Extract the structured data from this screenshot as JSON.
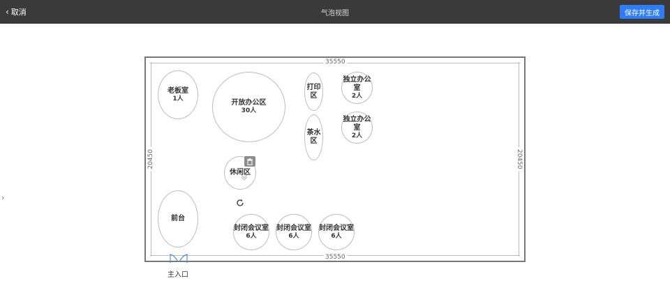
{
  "topbar": {
    "back_label": "取消",
    "title": "气泡视图",
    "save_label": "保存并生成"
  },
  "floorplan": {
    "width_label": "35550",
    "height_label": "20450",
    "entrance_label": "主入口"
  },
  "zones": [
    {
      "name": "老板室",
      "capacity": "1人"
    },
    {
      "name": "开放办公区",
      "capacity": "30人"
    },
    {
      "name": "打印区",
      "capacity": ""
    },
    {
      "name": "茶水区",
      "capacity": ""
    },
    {
      "name": "独立办公室",
      "capacity": "2人"
    },
    {
      "name": "独立办公室",
      "capacity": "2人"
    },
    {
      "name": "休闲区",
      "capacity": ""
    },
    {
      "name": "前台",
      "capacity": ""
    },
    {
      "name": "封闭会议室",
      "capacity": "6人"
    },
    {
      "name": "封闭会议室",
      "capacity": "6人"
    },
    {
      "name": "封闭会议室",
      "capacity": "6人"
    }
  ],
  "icons": {
    "back": "chevron-left-icon",
    "side_toggle": "chevron-right-icon",
    "delete": "trash-icon",
    "rotate": "rotate-icon",
    "door": "double-door-icon"
  },
  "colors": {
    "topbar": "#3a3a3a",
    "save_button": "#2f7df6",
    "door": "#4a90e2"
  }
}
